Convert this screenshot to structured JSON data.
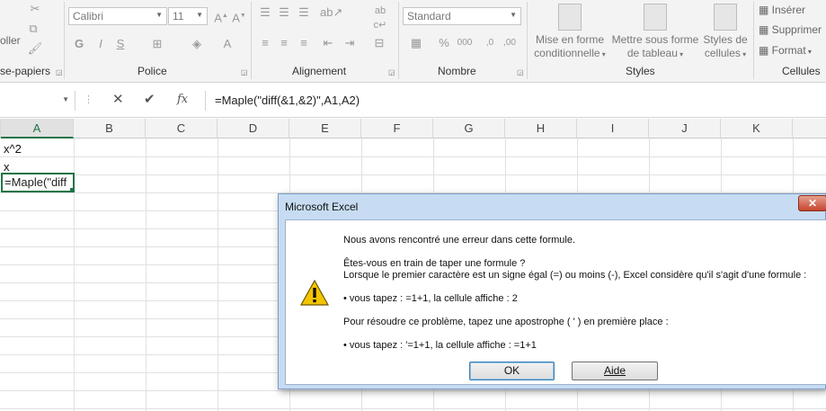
{
  "ribbon": {
    "clipboard": {
      "paste_label": "oller",
      "group_label": "se-papiers"
    },
    "font": {
      "font_name": "Calibri",
      "font_size": "11",
      "bold": "G",
      "italic": "I",
      "underline": "S",
      "group_label": "Police"
    },
    "alignment": {
      "group_label": "Alignement"
    },
    "number": {
      "format": "Standard",
      "percent": "%",
      "thousands": "000",
      "group_label": "Nombre"
    },
    "styles": {
      "conditional_formatting": [
        "Mise en forme",
        "conditionnelle"
      ],
      "format_as_table": [
        "Mettre sous forme",
        "de tableau"
      ],
      "cell_styles": [
        "Styles de",
        "cellules"
      ],
      "group_label": "Styles"
    },
    "cells": {
      "insert": "Insérer",
      "delete": "Supprimer",
      "format": "Format",
      "group_label": "Cellules"
    }
  },
  "formula_bar": {
    "name_box": "",
    "cancel": "✕",
    "enter": "✔",
    "fx": "fx",
    "formula": "=Maple(\"diff(&1,&2)\",A1,A2)"
  },
  "sheet": {
    "columns": [
      "A",
      "B",
      "C",
      "D",
      "E",
      "F",
      "G",
      "H",
      "I",
      "J",
      "K"
    ],
    "selected_column": "A",
    "cells": {
      "A1": "x^2",
      "A2": "x",
      "A3": "=Maple(\"diff"
    }
  },
  "dialog": {
    "title": "Microsoft Excel",
    "close": "✕",
    "lines": [
      "Nous avons rencontré une erreur dans cette formule.",
      "Êtes-vous en train de taper une formule ?",
      "Lorsque le premier caractère est un signe égal (=) ou moins (-), Excel considère qu'il s'agit d'une formule :",
      "• vous tapez :   =1+1, la cellule affiche :   2",
      "Pour résoudre ce problème, tapez une apostrophe ( ' ) en première place :",
      "• vous tapez :   '=1+1, la cellule affiche :   =1+1"
    ],
    "ok": "OK",
    "help": "Aide"
  },
  "colors": {
    "excel_green": "#217346",
    "dialog_frame": "#c7dcf2",
    "close_red": "#c6452f",
    "warning_yellow": "#f5c400"
  }
}
